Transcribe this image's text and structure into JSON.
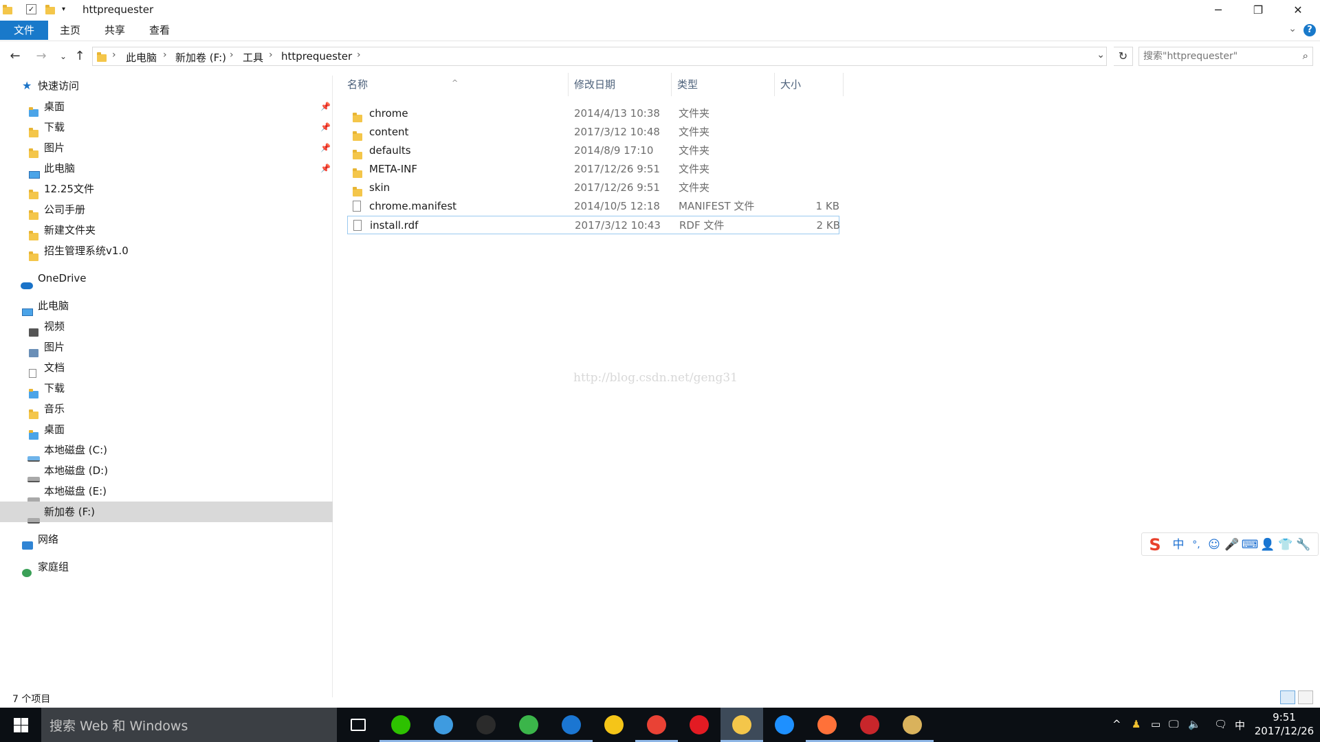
{
  "window": {
    "title": "httprequester",
    "minimize": "─",
    "restore": "❐",
    "close": "✕"
  },
  "ribbon": {
    "tabs": [
      "文件",
      "主页",
      "共享",
      "查看"
    ],
    "help": "?"
  },
  "address": {
    "crumbs": [
      "此电脑",
      "新加卷 (F:)",
      "工具",
      "httprequester"
    ],
    "search_placeholder": "搜索\"httprequester\""
  },
  "nav": {
    "quick_access": "快速访问",
    "quick_items": [
      "桌面",
      "下载",
      "图片",
      "此电脑",
      "12.25文件",
      "公司手册",
      "新建文件夹",
      "招生管理系统v1.0"
    ],
    "onedrive": "OneDrive",
    "this_pc": "此电脑",
    "pc_items": [
      "视频",
      "图片",
      "文档",
      "下载",
      "音乐",
      "桌面",
      "本地磁盘 (C:)",
      "本地磁盘 (D:)",
      "本地磁盘 (E:)",
      "新加卷 (F:)"
    ],
    "network": "网络",
    "homegroup": "家庭组"
  },
  "columns": {
    "name": "名称",
    "date": "修改日期",
    "type": "类型",
    "size": "大小"
  },
  "files": [
    {
      "name": "chrome",
      "date": "2014/4/13 10:38",
      "type": "文件夹",
      "size": "",
      "kind": "folder"
    },
    {
      "name": "content",
      "date": "2017/3/12 10:48",
      "type": "文件夹",
      "size": "",
      "kind": "folder"
    },
    {
      "name": "defaults",
      "date": "2014/8/9 17:10",
      "type": "文件夹",
      "size": "",
      "kind": "folder"
    },
    {
      "name": "META-INF",
      "date": "2017/12/26 9:51",
      "type": "文件夹",
      "size": "",
      "kind": "folder"
    },
    {
      "name": "skin",
      "date": "2017/12/26 9:51",
      "type": "文件夹",
      "size": "",
      "kind": "folder"
    },
    {
      "name": "chrome.manifest",
      "date": "2014/10/5 12:18",
      "type": "MANIFEST 文件",
      "size": "1 KB",
      "kind": "file"
    },
    {
      "name": "install.rdf",
      "date": "2017/3/12 10:43",
      "type": "RDF 文件",
      "size": "2 KB",
      "kind": "file"
    }
  ],
  "watermark": "http://blog.csdn.net/geng31",
  "status": {
    "count": "7 个项目"
  },
  "ime": {
    "logo": "S",
    "mode": "中",
    "punct": "°,"
  },
  "taskbar": {
    "search": "搜索 Web 和 Windows",
    "apps": [
      {
        "name": "task-view-icon",
        "color": "#0b0f14"
      },
      {
        "name": "wechat-icon",
        "color": "#2dc100"
      },
      {
        "name": "browser-360-icon",
        "color": "#3e9be0"
      },
      {
        "name": "terminal-icon",
        "color": "#2b2b2b"
      },
      {
        "name": "browser-360-green-icon",
        "color": "#3bb54a"
      },
      {
        "name": "intellij-icon",
        "color": "#1b76d2"
      },
      {
        "name": "chat-app-icon",
        "color": "#f5c518"
      },
      {
        "name": "chrome-icon",
        "color": "#e94235"
      },
      {
        "name": "app-red-icon",
        "color": "#e31b23"
      },
      {
        "name": "file-explorer-icon",
        "color": "#f4c64a"
      },
      {
        "name": "edge-icon",
        "color": "#1e90ff"
      },
      {
        "name": "firefox-icon",
        "color": "#ff7139"
      },
      {
        "name": "app-document-icon",
        "color": "#c8262b"
      },
      {
        "name": "paint-icon",
        "color": "#d9b25c"
      }
    ],
    "ime_indicator": "中",
    "time": "9:51",
    "date": "2017/12/26"
  }
}
